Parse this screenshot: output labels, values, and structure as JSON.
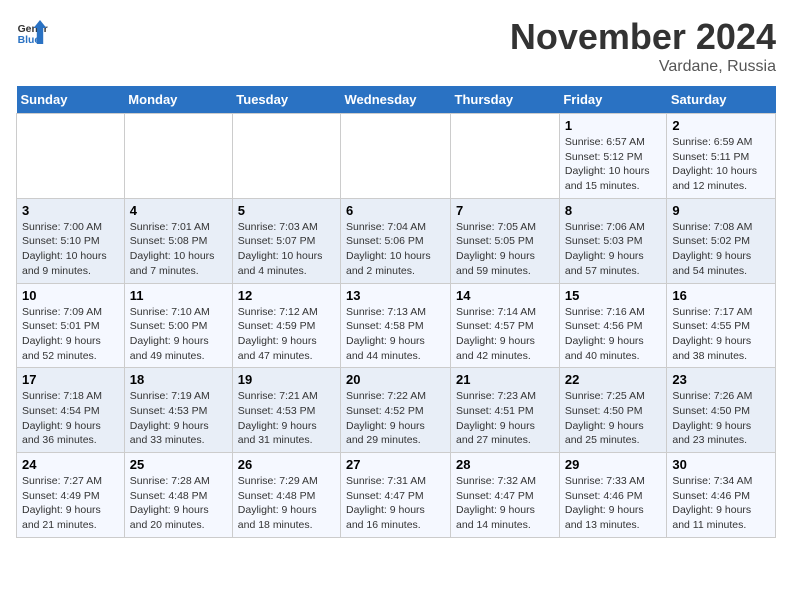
{
  "header": {
    "logo_line1": "General",
    "logo_line2": "Blue",
    "month": "November 2024",
    "location": "Vardane, Russia"
  },
  "weekdays": [
    "Sunday",
    "Monday",
    "Tuesday",
    "Wednesday",
    "Thursday",
    "Friday",
    "Saturday"
  ],
  "weeks": [
    [
      {
        "day": "",
        "detail": ""
      },
      {
        "day": "",
        "detail": ""
      },
      {
        "day": "",
        "detail": ""
      },
      {
        "day": "",
        "detail": ""
      },
      {
        "day": "",
        "detail": ""
      },
      {
        "day": "1",
        "detail": "Sunrise: 6:57 AM\nSunset: 5:12 PM\nDaylight: 10 hours and 15 minutes."
      },
      {
        "day": "2",
        "detail": "Sunrise: 6:59 AM\nSunset: 5:11 PM\nDaylight: 10 hours and 12 minutes."
      }
    ],
    [
      {
        "day": "3",
        "detail": "Sunrise: 7:00 AM\nSunset: 5:10 PM\nDaylight: 10 hours and 9 minutes."
      },
      {
        "day": "4",
        "detail": "Sunrise: 7:01 AM\nSunset: 5:08 PM\nDaylight: 10 hours and 7 minutes."
      },
      {
        "day": "5",
        "detail": "Sunrise: 7:03 AM\nSunset: 5:07 PM\nDaylight: 10 hours and 4 minutes."
      },
      {
        "day": "6",
        "detail": "Sunrise: 7:04 AM\nSunset: 5:06 PM\nDaylight: 10 hours and 2 minutes."
      },
      {
        "day": "7",
        "detail": "Sunrise: 7:05 AM\nSunset: 5:05 PM\nDaylight: 9 hours and 59 minutes."
      },
      {
        "day": "8",
        "detail": "Sunrise: 7:06 AM\nSunset: 5:03 PM\nDaylight: 9 hours and 57 minutes."
      },
      {
        "day": "9",
        "detail": "Sunrise: 7:08 AM\nSunset: 5:02 PM\nDaylight: 9 hours and 54 minutes."
      }
    ],
    [
      {
        "day": "10",
        "detail": "Sunrise: 7:09 AM\nSunset: 5:01 PM\nDaylight: 9 hours and 52 minutes."
      },
      {
        "day": "11",
        "detail": "Sunrise: 7:10 AM\nSunset: 5:00 PM\nDaylight: 9 hours and 49 minutes."
      },
      {
        "day": "12",
        "detail": "Sunrise: 7:12 AM\nSunset: 4:59 PM\nDaylight: 9 hours and 47 minutes."
      },
      {
        "day": "13",
        "detail": "Sunrise: 7:13 AM\nSunset: 4:58 PM\nDaylight: 9 hours and 44 minutes."
      },
      {
        "day": "14",
        "detail": "Sunrise: 7:14 AM\nSunset: 4:57 PM\nDaylight: 9 hours and 42 minutes."
      },
      {
        "day": "15",
        "detail": "Sunrise: 7:16 AM\nSunset: 4:56 PM\nDaylight: 9 hours and 40 minutes."
      },
      {
        "day": "16",
        "detail": "Sunrise: 7:17 AM\nSunset: 4:55 PM\nDaylight: 9 hours and 38 minutes."
      }
    ],
    [
      {
        "day": "17",
        "detail": "Sunrise: 7:18 AM\nSunset: 4:54 PM\nDaylight: 9 hours and 36 minutes."
      },
      {
        "day": "18",
        "detail": "Sunrise: 7:19 AM\nSunset: 4:53 PM\nDaylight: 9 hours and 33 minutes."
      },
      {
        "day": "19",
        "detail": "Sunrise: 7:21 AM\nSunset: 4:53 PM\nDaylight: 9 hours and 31 minutes."
      },
      {
        "day": "20",
        "detail": "Sunrise: 7:22 AM\nSunset: 4:52 PM\nDaylight: 9 hours and 29 minutes."
      },
      {
        "day": "21",
        "detail": "Sunrise: 7:23 AM\nSunset: 4:51 PM\nDaylight: 9 hours and 27 minutes."
      },
      {
        "day": "22",
        "detail": "Sunrise: 7:25 AM\nSunset: 4:50 PM\nDaylight: 9 hours and 25 minutes."
      },
      {
        "day": "23",
        "detail": "Sunrise: 7:26 AM\nSunset: 4:50 PM\nDaylight: 9 hours and 23 minutes."
      }
    ],
    [
      {
        "day": "24",
        "detail": "Sunrise: 7:27 AM\nSunset: 4:49 PM\nDaylight: 9 hours and 21 minutes."
      },
      {
        "day": "25",
        "detail": "Sunrise: 7:28 AM\nSunset: 4:48 PM\nDaylight: 9 hours and 20 minutes."
      },
      {
        "day": "26",
        "detail": "Sunrise: 7:29 AM\nSunset: 4:48 PM\nDaylight: 9 hours and 18 minutes."
      },
      {
        "day": "27",
        "detail": "Sunrise: 7:31 AM\nSunset: 4:47 PM\nDaylight: 9 hours and 16 minutes."
      },
      {
        "day": "28",
        "detail": "Sunrise: 7:32 AM\nSunset: 4:47 PM\nDaylight: 9 hours and 14 minutes."
      },
      {
        "day": "29",
        "detail": "Sunrise: 7:33 AM\nSunset: 4:46 PM\nDaylight: 9 hours and 13 minutes."
      },
      {
        "day": "30",
        "detail": "Sunrise: 7:34 AM\nSunset: 4:46 PM\nDaylight: 9 hours and 11 minutes."
      }
    ]
  ]
}
